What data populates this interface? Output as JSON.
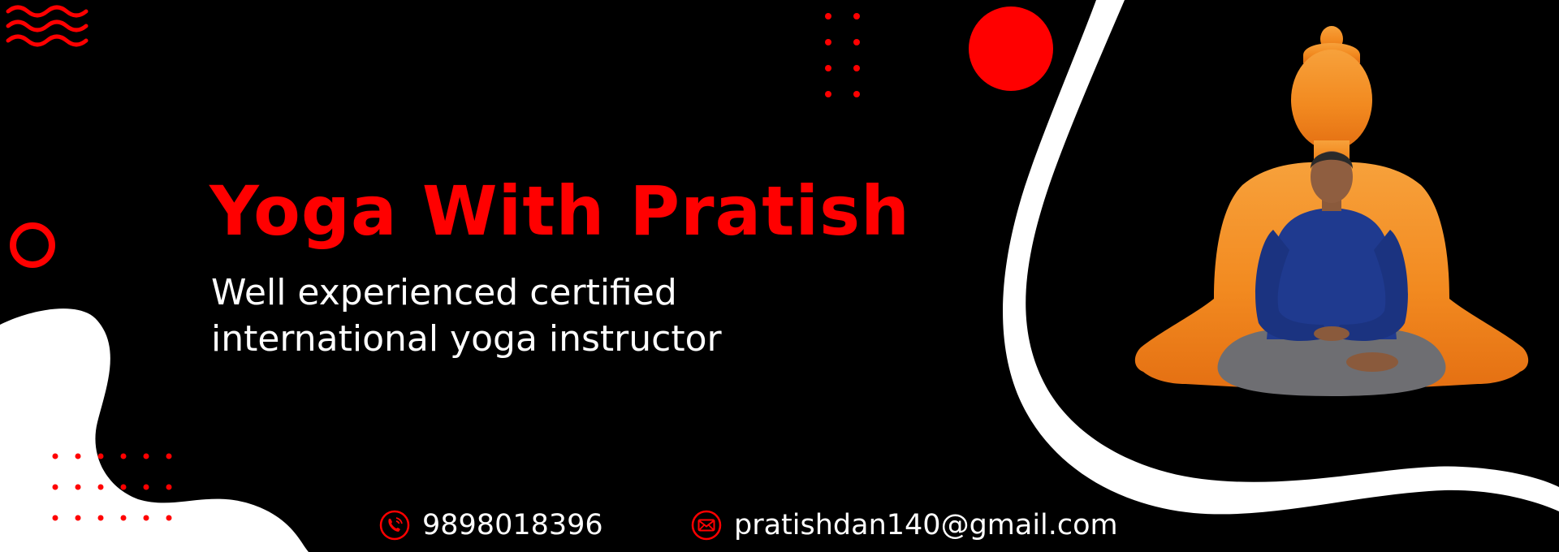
{
  "banner": {
    "title": "Yoga With Pratish",
    "subtitle_lines": [
      "Well experienced certified",
      "international yoga instructor"
    ]
  },
  "contacts": {
    "phone": {
      "icon": "phone-icon",
      "value": "9898018396"
    },
    "email": {
      "icon": "mail-icon",
      "value": "pratishdan140@gmail.com"
    }
  },
  "colors": {
    "background": "#000000",
    "accent": "#ff0000",
    "figure_orange": "#f28a20",
    "text": "#ffffff"
  }
}
